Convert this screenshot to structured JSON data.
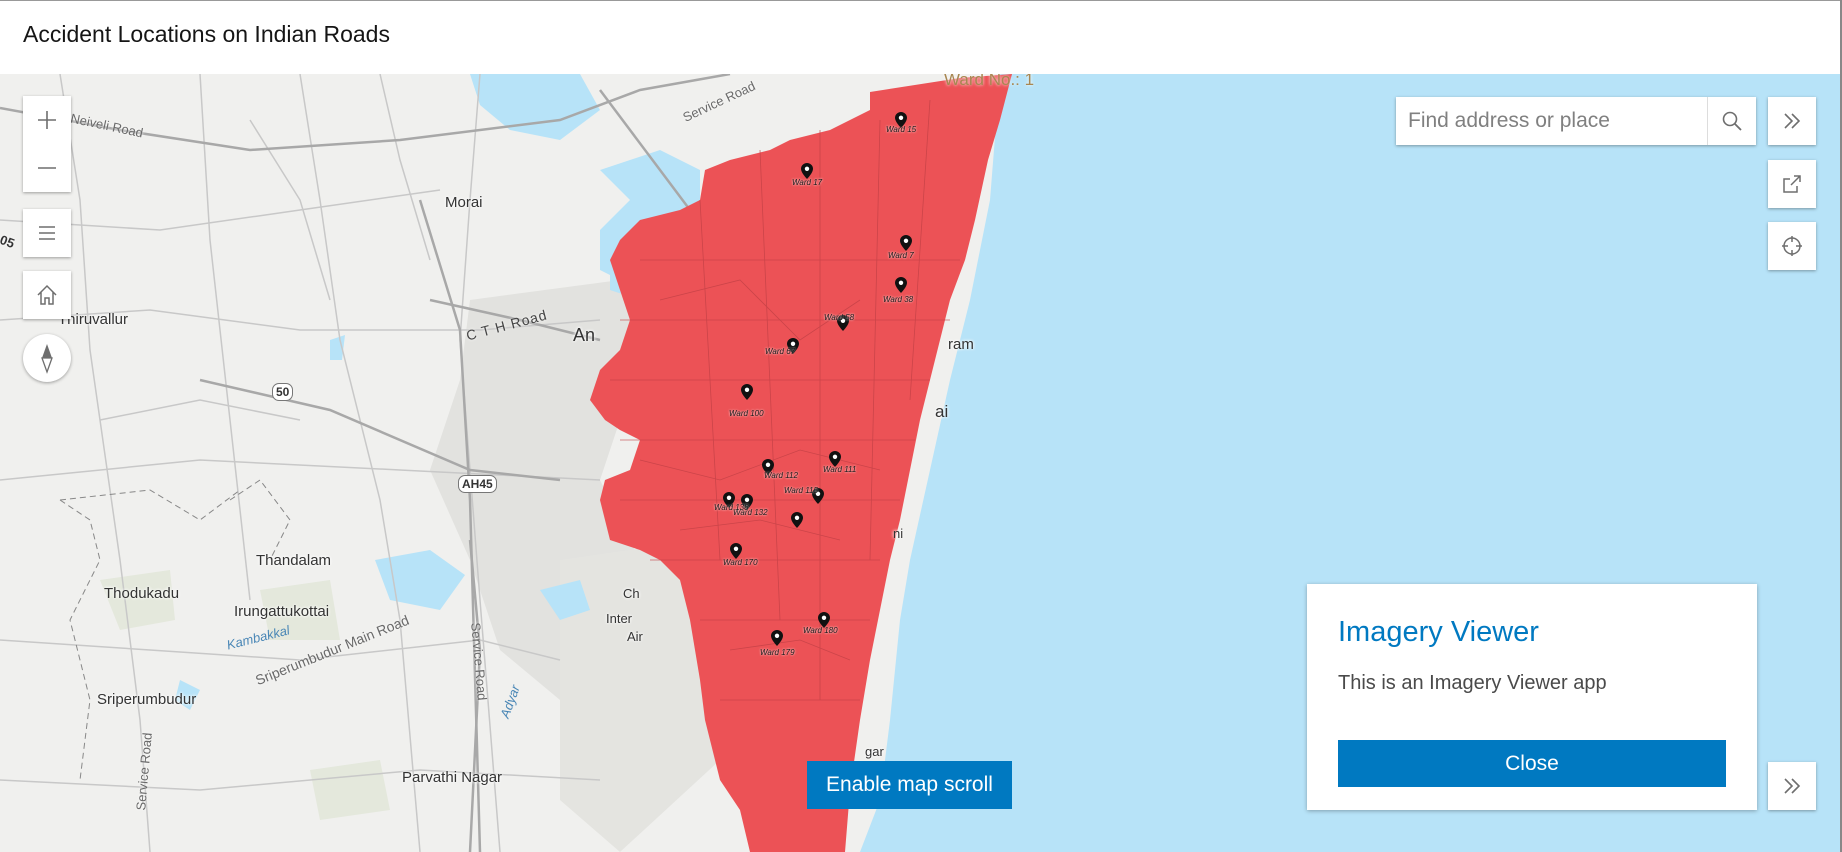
{
  "header": {
    "title": "Accident Locations on Indian Roads"
  },
  "search": {
    "placeholder": "Find address or place"
  },
  "map": {
    "ward_boundary_label": "Ward No.: 1",
    "wards": [
      {
        "label": "Ward 15"
      },
      {
        "label": "Ward 17"
      },
      {
        "label": "Ward 7"
      },
      {
        "label": "Ward 38"
      },
      {
        "label": "Ward 58"
      },
      {
        "label": "Ward 67"
      },
      {
        "label": "Ward 100"
      },
      {
        "label": "Ward 111"
      },
      {
        "label": "Ward 112"
      },
      {
        "label": "Ward 115"
      },
      {
        "label": "Ward 132"
      },
      {
        "label": "Ward 138"
      },
      {
        "label": "Ward 170"
      },
      {
        "label": "Ward 180"
      },
      {
        "label": "Ward 179"
      }
    ],
    "places": [
      "Morai",
      "Thiruvallur",
      "Thandalam",
      "Thodukadu",
      "Irungattukottai",
      "Sriperumbudur",
      "Parvathi Nagar",
      "An",
      "ram",
      "ai",
      "ni",
      "Ch",
      "Inter",
      "Air",
      "gar"
    ],
    "roads": [
      "Neiveli Road",
      "Service Road",
      "C T H Road",
      "Sriperumbudur Main Road",
      "Service Road",
      "Service Road",
      "05"
    ],
    "water": [
      "Kambakkal",
      "Adyar"
    ],
    "shields": [
      "50",
      "AH45"
    ],
    "colors": {
      "ward_fill": "#ec5256",
      "water": "#b7e3f8",
      "land": "#f0f0ee",
      "accent": "#0079c1"
    }
  },
  "controls": {
    "zoom_in": "plus-icon",
    "zoom_out": "minus-icon",
    "layer_list": "list-icon",
    "home": "home-icon",
    "compass": "compass-icon",
    "expand": "double-chevron-right-icon",
    "share": "share-icon",
    "locate": "locate-icon"
  },
  "enable_scroll": {
    "label": "Enable map scroll"
  },
  "info_panel": {
    "title": "Imagery Viewer",
    "description": "This is an Imagery Viewer app",
    "close_label": "Close"
  }
}
